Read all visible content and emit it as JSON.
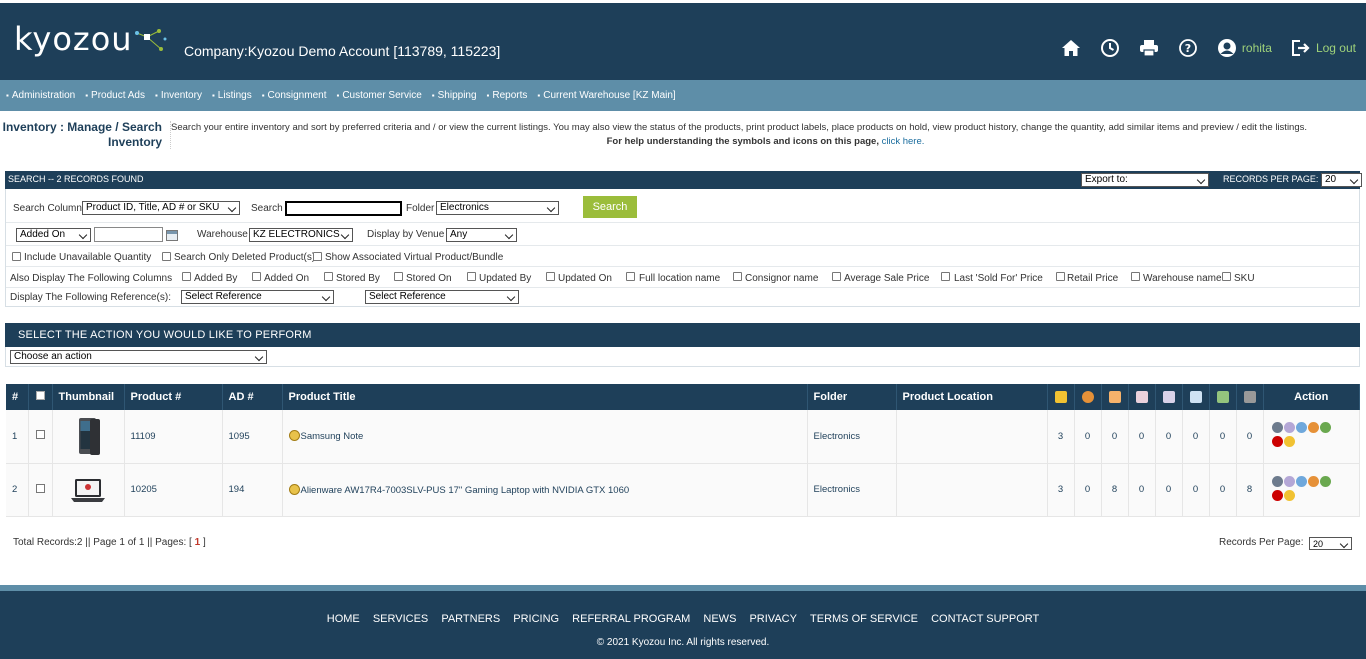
{
  "header": {
    "logo": "kyozou",
    "company": "Company:Kyozou Demo Account [113789, 115223]",
    "user": "rohita",
    "logout": "Log out"
  },
  "nav": {
    "items": [
      "Administration",
      "Product Ads",
      "Inventory",
      "Listings",
      "Consignment",
      "Customer Service",
      "Shipping",
      "Reports",
      "Current Warehouse [KZ Main]"
    ]
  },
  "page": {
    "title_line1": "Inventory : Manage / Search",
    "title_line2": "Inventory",
    "description": "Search your entire inventory and sort by preferred criteria and / or view the current listings. You may also view the status of the products, print product labels, place products on hold, view product history, change the quantity, add similar items and preview / edit the listings.",
    "help_text": "For help understanding the symbols and icons on this page,",
    "help_link": "click here."
  },
  "search": {
    "bar_title": "SEARCH -- 2 RECORDS FOUND",
    "export_value": "Export to:",
    "rpp_label": "RECORDS PER PAGE:",
    "rpp_value": "20",
    "column_label": "Search Column",
    "column_value": "Product ID, Title, AD # or SKU",
    "search_label": "Search",
    "search_value": "",
    "folder_label": "Folder",
    "folder_value": "Electronics",
    "search_button": "Search",
    "date_field_value": "Added On",
    "date_input_value": "",
    "warehouse_label": "Warehouse",
    "warehouse_value": "KZ ELECTRONICS",
    "venue_label": "Display by Venue",
    "venue_value": "Any",
    "include_unavailable": "Include Unavailable Quantity",
    "search_deleted": "Search Only Deleted Product(s)",
    "show_associated": "Show Associated Virtual Product/Bundle",
    "also_display_label": "Also Display The Following Columns",
    "columns": [
      "Added By",
      "Added On",
      "Stored By",
      "Stored On",
      "Updated By",
      "Updated On",
      "Full location name",
      "Consignor name",
      "Average Sale Price",
      "Last 'Sold For' Price",
      "Retail Price",
      "Warehouse name",
      "SKU"
    ],
    "reference_label": "Display The Following Reference(s):",
    "reference1": "Select Reference",
    "reference2": "Select Reference"
  },
  "action": {
    "bar_title": "SELECT THE ACTION YOU WOULD LIKE TO PERFORM",
    "select_value": "Choose an action"
  },
  "table": {
    "headers": {
      "num": "#",
      "thumbnail": "Thumbnail",
      "product": "Product #",
      "ad": "AD #",
      "title": "Product Title",
      "folder": "Folder",
      "location": "Product Location",
      "action": "Action"
    },
    "rows": [
      {
        "num": "1",
        "product": "11109",
        "ad": "1095",
        "title": "Samsung Note",
        "folder": "Electronics",
        "location": "",
        "counts": [
          "3",
          "0",
          "0",
          "0",
          "0",
          "0",
          "0",
          "0"
        ]
      },
      {
        "num": "2",
        "product": "10205",
        "ad": "194",
        "title": "Alienware AW17R4-7003SLV-PUS 17\" Gaming Laptop with NVIDIA GTX 1060",
        "folder": "Electronics",
        "location": "",
        "counts": [
          "3",
          "0",
          "8",
          "0",
          "0",
          "0",
          "0",
          "8"
        ]
      }
    ]
  },
  "status": {
    "total_prefix": "Total Records:2 || Page 1 of 1 || Pages: [",
    "current_page": "1",
    "total_suffix": "]",
    "rpp_label": "Records Per Page:",
    "rpp_value": "20"
  },
  "footer": {
    "links": [
      "HOME",
      "SERVICES",
      "PARTNERS",
      "PRICING",
      "REFERRAL PROGRAM",
      "NEWS",
      "PRIVACY",
      "TERMS OF SERVICE",
      "CONTACT SUPPORT"
    ],
    "copyright": "© 2021 Kyozou Inc. All rights reserved."
  }
}
